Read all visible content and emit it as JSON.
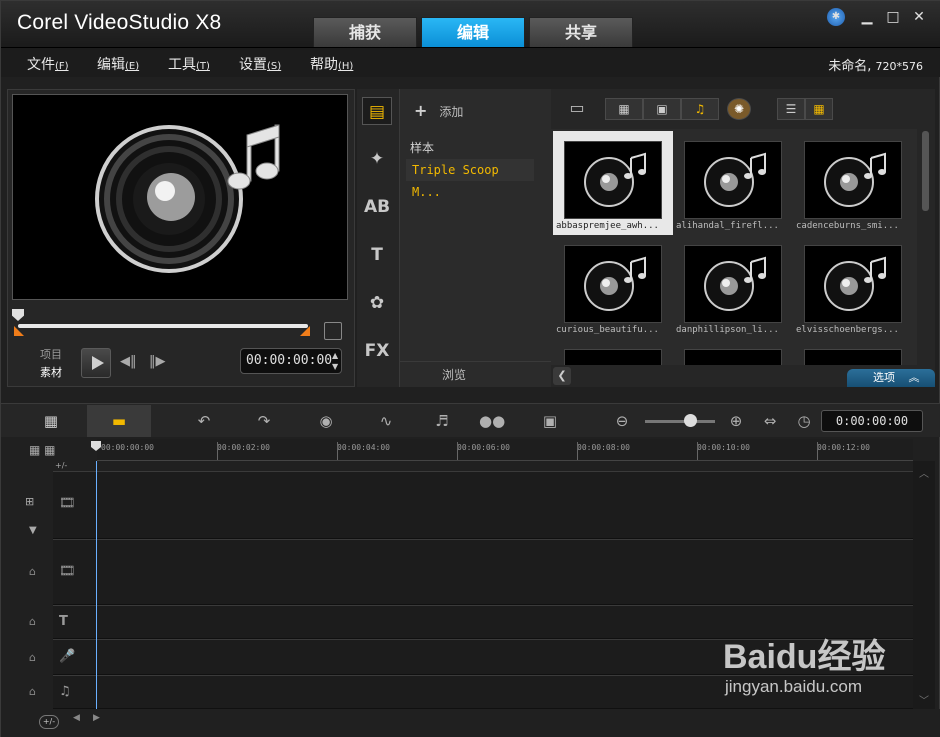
{
  "app": {
    "title": "Corel VideoStudio X8"
  },
  "tabs": [
    {
      "label": "捕获"
    },
    {
      "label": "编辑"
    },
    {
      "label": "共享"
    }
  ],
  "menu": [
    {
      "label": "文件",
      "key": "(F)"
    },
    {
      "label": "编辑",
      "key": "(E)"
    },
    {
      "label": "工具",
      "key": "(T)"
    },
    {
      "label": "设置",
      "key": "(S)"
    },
    {
      "label": "帮助",
      "key": "(H)"
    }
  ],
  "project": {
    "name": "未命名,",
    "resolution": "720*576"
  },
  "preview": {
    "mode_project": "项目",
    "mode_clip": "素材",
    "timecode": "00:00:00:00"
  },
  "library": {
    "add_label": "添加",
    "folders": [
      "样本",
      "Triple Scoop M..."
    ],
    "browse_label": "浏览",
    "options_label": "选项",
    "items": [
      {
        "label": "abbaspremjee_awh..."
      },
      {
        "label": "alihandal_firefl..."
      },
      {
        "label": "cadenceburns_smi..."
      },
      {
        "label": "curious_beautifu..."
      },
      {
        "label": "danphillipson_li..."
      },
      {
        "label": "elvisschoenbergs..."
      }
    ]
  },
  "timeline": {
    "timecode": "0:00:00:00",
    "ruler": [
      "00:00:00:00",
      "00:00:02:00",
      "00:00:04:00",
      "00:00:06:00",
      "00:00:08:00",
      "00:00:10:00",
      "00:00:12:00"
    ],
    "add_track": "+/-"
  },
  "watermark": {
    "logo": "Baidu经验",
    "url": "jingyan.baidu.com"
  },
  "colors": {
    "active_tab": "#1aa3e8",
    "accent": "#f2b900",
    "marker": "#f07d1a"
  }
}
